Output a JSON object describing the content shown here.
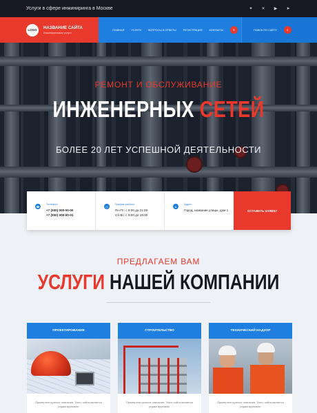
{
  "topbar": {
    "text": "Услуги в сфере инжиниринга в Москве",
    "socials": [
      "vk-icon",
      "twitter-icon",
      "youtube-icon",
      "telegram-icon"
    ]
  },
  "brand": {
    "logo": "LOGO",
    "title": "НАЗВАНИЕ САЙТА",
    "subtitle": "Инжиниринговые услуги"
  },
  "nav": {
    "items": [
      "ГЛАВНАЯ",
      "УСЛУГИ",
      "ВОПРОСЫ И ОТВЕТЫ",
      "РЕГИСТРАЦИЯ",
      "КОНТАКТЫ"
    ],
    "search_label": "ПОИСК ПО САЙТУ"
  },
  "hero": {
    "kicker": "РЕМОНТ И ОБСЛУЖИВАНИЕ",
    "title_a": "ИНЖЕНЕРНЫХ",
    "title_b": "СЕТЕЙ",
    "subtitle": "БОЛЕЕ 20 ЛЕТ УСПЕШНОЙ ДЕЯТЕЛЬНОСТИ"
  },
  "contact": {
    "phone_label": "Телефон",
    "phone1": "+7 (000) 000-00-00",
    "phone2": "+7 (000) 000-00-01",
    "hours_label": "График работы",
    "hours1": "Пн-Пт: с 9:00 до 21:00",
    "hours2": "Сб-Вс: с 9:00 до 19:00",
    "address_label": "Адрес",
    "address": "Город, название улицы, дом 1",
    "button": "ОСТАВИТЬ ЗАЯВКУ"
  },
  "services": {
    "kicker": "ПРЕДЛАГАЕМ ВАМ",
    "title_a": "УСЛУГИ",
    "title_b": "НАШЕЙ КОМПАНИИ",
    "cards": [
      {
        "title": "ПРОЕКТИРОВАНИЕ",
        "text": "Примерное краткое описание. Текст сайта является редактируемым."
      },
      {
        "title": "СТРОИТЕЛЬСТВО",
        "text": "Примерное краткое описание. Текст сайта является редактируемым."
      },
      {
        "title": "ТЕХНИЧЕСКИЙ НАДЗОР",
        "text": "Примерное краткое описание. Текст сайта является редактируемым."
      }
    ]
  },
  "colors": {
    "accent": "#e8392c",
    "primary": "#1e7fe0",
    "dark": "#16191f"
  }
}
